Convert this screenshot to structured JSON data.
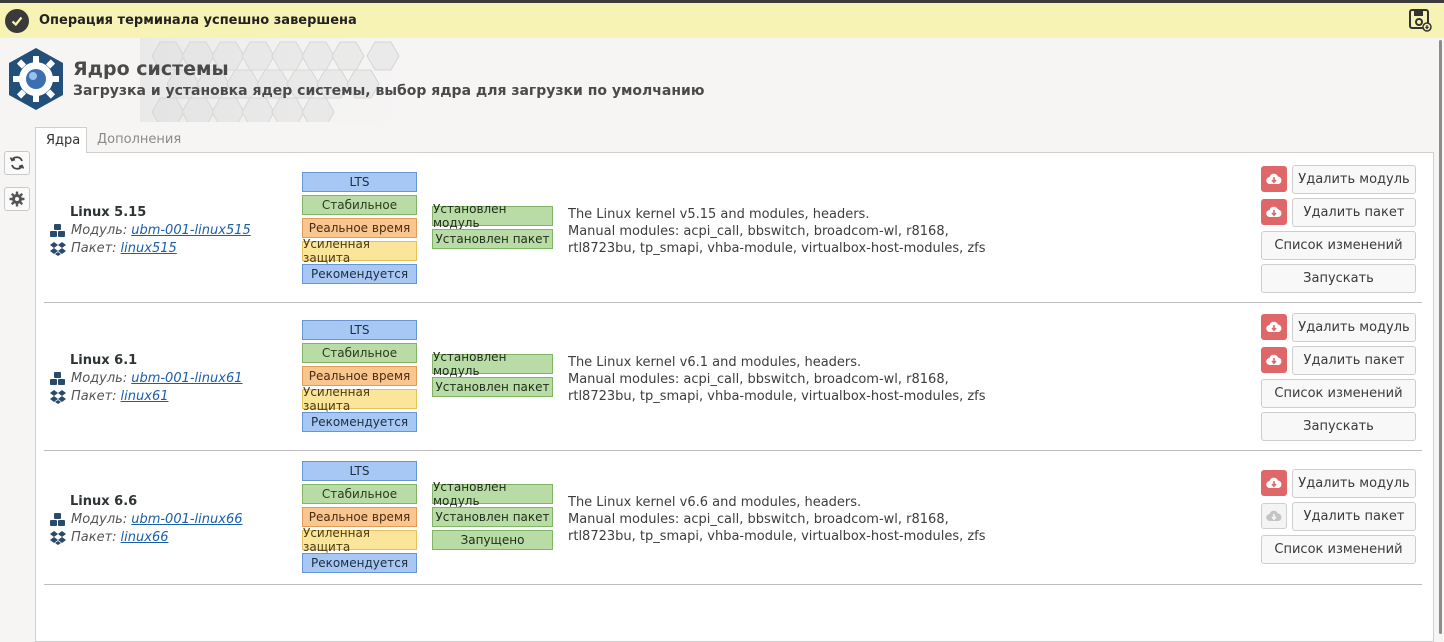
{
  "notification": {
    "text": "Операция терминала успешно завершена"
  },
  "header": {
    "title": "Ядро системы",
    "subtitle": "Загрузка и установка ядер системы, выбор ядра для загрузки по умолчанию"
  },
  "tabs": [
    {
      "label": "Ядра",
      "active": true
    },
    {
      "label": "Дополнения",
      "active": false
    }
  ],
  "labels": {
    "module": "Модуль:",
    "package": "Пакет:"
  },
  "badge_labels": {
    "lts": "LTS",
    "stable": "Стабильное",
    "realtime": "Реальное время",
    "hardened": "Усиленная защита",
    "recommended": "Рекомендуется"
  },
  "kernels": [
    {
      "name": "Linux 5.15",
      "module": "ubm-001-linux515",
      "package": "linux515",
      "statuses": [
        "Установлен модуль",
        "Установлен пакет"
      ],
      "desc1": "The Linux kernel v5.15 and modules, headers.",
      "desc2": "Manual modules: acpi_call, bbswitch, broadcom-wl, r8168,",
      "desc3": "rtl8723bu, tp_smapi, vhba-module, virtualbox-host-modules, zfs",
      "buttons": [
        "Удалить модуль",
        "Удалить пакет",
        "Список изменений",
        "Запускать"
      ]
    },
    {
      "name": "Linux 6.1",
      "module": "ubm-001-linux61",
      "package": "linux61",
      "statuses": [
        "Установлен модуль",
        "Установлен пакет"
      ],
      "desc1": "The Linux kernel v6.1 and modules, headers.",
      "desc2": "Manual modules: acpi_call, bbswitch, broadcom-wl, r8168,",
      "desc3": "rtl8723bu, tp_smapi, vhba-module, virtualbox-host-modules, zfs",
      "buttons": [
        "Удалить модуль",
        "Удалить пакет",
        "Список изменений",
        "Запускать"
      ]
    },
    {
      "name": "Linux 6.6",
      "module": "ubm-001-linux66",
      "package": "linux66",
      "statuses": [
        "Установлен модуль",
        "Установлен пакет",
        "Запущено"
      ],
      "desc1": "The Linux kernel v6.6 and modules, headers.",
      "desc2": "Manual modules: acpi_call, bbswitch, broadcom-wl, r8168,",
      "desc3": "rtl8723bu, tp_smapi, vhba-module, virtualbox-host-modules, zfs",
      "buttons": [
        "Удалить модуль",
        "Удалить пакет",
        "Список изменений"
      ]
    }
  ],
  "colors": {
    "notify_bg": "#f7f3b4",
    "badge_blue": "#a7c7f4",
    "badge_green": "#b9dca6",
    "badge_orange": "#f9c690",
    "badge_yellow": "#fbe59a",
    "danger": "#e06767",
    "link": "#1b5faa"
  },
  "icons": {
    "notify": "checkmark-circle-icon",
    "save": "save-icon",
    "refresh": "refresh-icon",
    "settings": "gear-icon",
    "module": "cubes-icon",
    "package": "dropbox-icon",
    "remove": "cloud-download-icon"
  }
}
